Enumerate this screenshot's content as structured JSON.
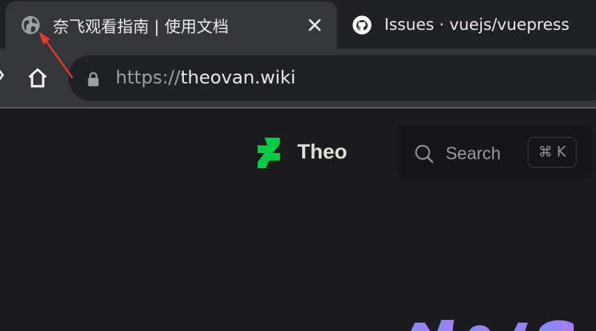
{
  "browser": {
    "active_tab": {
      "title": "奈飞观看指南 | 使用文档",
      "favicon": "globe-icon"
    },
    "inactive_tab": {
      "title": "Issues · vuejs/vuepress",
      "favicon": "github-icon"
    },
    "address_bar": {
      "scheme": "https://",
      "host": "theovan.wiki"
    }
  },
  "site": {
    "title": "Theo",
    "logo": "deviantart-logo-icon",
    "search": {
      "label": "Search",
      "shortcut": "⌘ K"
    }
  },
  "colors": {
    "page_background": "#1b1b1f",
    "logo_green": "#05cc47",
    "annotation_red": "#e8382f",
    "hero_gradient_start": "#bd34fe",
    "hero_gradient_end": "#7c8cf8"
  }
}
